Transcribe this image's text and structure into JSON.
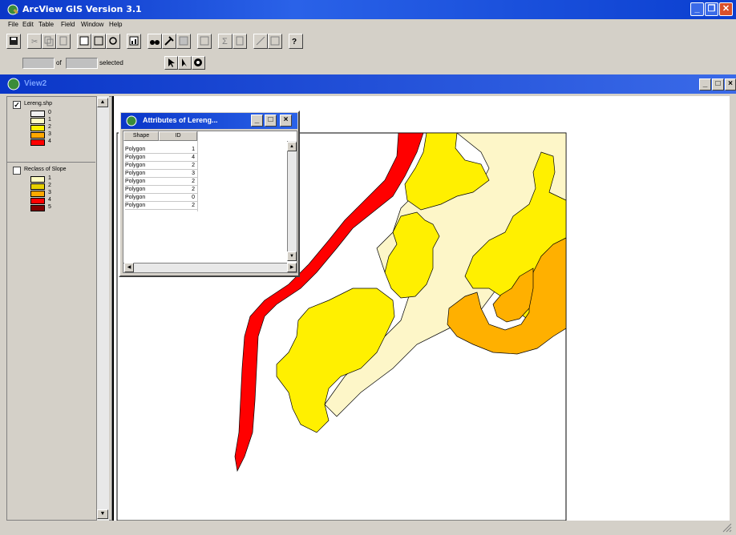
{
  "app": {
    "title": "ArcView GIS Version 3.1",
    "menu": [
      "File",
      "Edit",
      "Table",
      "Field",
      "Window",
      "Help"
    ],
    "window_controls": [
      "minimize",
      "restore",
      "close"
    ]
  },
  "selection_bar": {
    "of_label": "of",
    "selected_label": "selected"
  },
  "view": {
    "title": "View2"
  },
  "toc": {
    "themes": [
      {
        "name": "Lereng.shp",
        "checked": true,
        "classes": [
          {
            "label": "0",
            "color": "#f0f0f0"
          },
          {
            "label": "1",
            "color": "#fffcc0"
          },
          {
            "label": "2",
            "color": "#fff000"
          },
          {
            "label": "3",
            "color": "#ffa800"
          },
          {
            "label": "4",
            "color": "#ff0000"
          }
        ]
      },
      {
        "name": "Reclass of Slope",
        "checked": false,
        "classes": [
          {
            "label": "1",
            "color": "#fffcc0"
          },
          {
            "label": "2",
            "color": "#e8d000"
          },
          {
            "label": "3",
            "color": "#ffa800"
          },
          {
            "label": "4",
            "color": "#ff0000"
          },
          {
            "label": "5",
            "color": "#800000"
          }
        ]
      }
    ]
  },
  "attributes_window": {
    "title": "Attributes of Lereng...",
    "columns": [
      "Shape",
      "ID"
    ],
    "rows": [
      [
        "Polygon",
        "1"
      ],
      [
        "Polygon",
        "4"
      ],
      [
        "Polygon",
        "2"
      ],
      [
        "Polygon",
        "3"
      ],
      [
        "Polygon",
        "2"
      ],
      [
        "Polygon",
        "2"
      ],
      [
        "Polygon",
        "0"
      ],
      [
        "Polygon",
        "2"
      ]
    ]
  },
  "colors": {
    "titlebar": "#0a36c8",
    "red": "#ff0000",
    "yellow": "#fff000",
    "pale": "#fdf6c8",
    "orange": "#ffa800"
  }
}
